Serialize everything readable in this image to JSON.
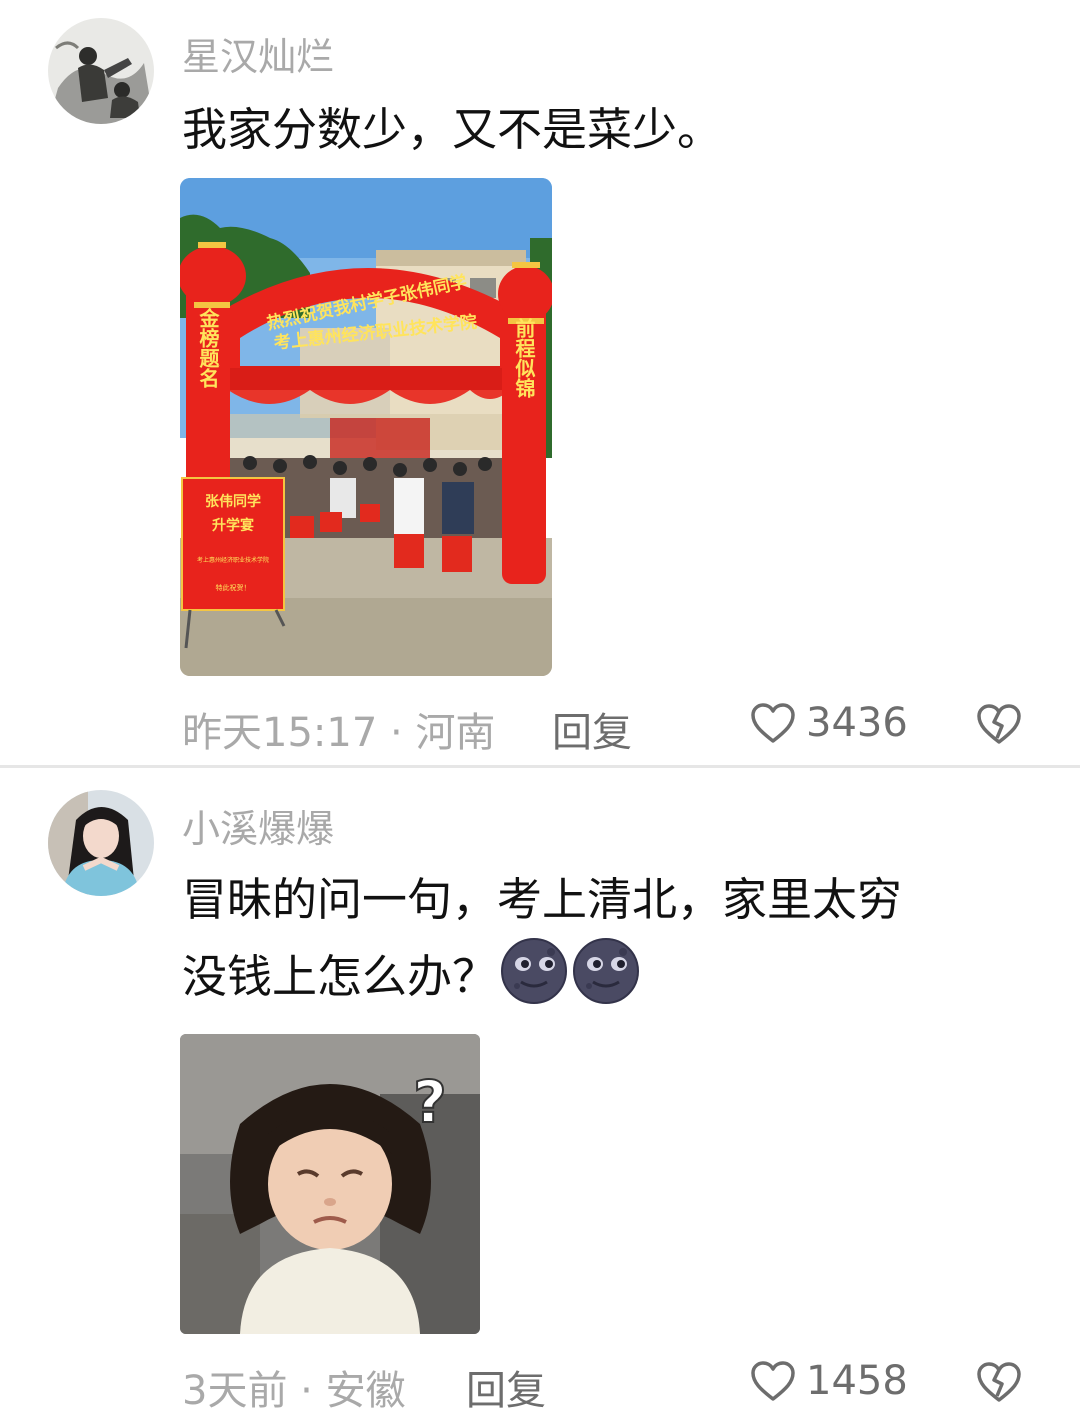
{
  "comments": [
    {
      "username": "星汉灿烂",
      "text": "我家分数少，又不是菜少。",
      "image": {
        "arch_banner_line1": "热烈祝贺我村学子张伟同学",
        "arch_banner_line2": "考上惠州经济职业技术学院",
        "left_pillar": "金榜题名",
        "right_pillar": "前程似锦",
        "sign_title_line1": "张伟同学",
        "sign_title_line2": "升学宴",
        "sign_body": "考上惠州经济职业技术学院",
        "sign_footer": "特此祝贺！"
      },
      "time": "昨天15:17",
      "location": "河南",
      "meta_separator": "·",
      "reply_label": "回复",
      "like_icon": "heart-outline-icon",
      "likes": "3436",
      "dislike_icon": "broken-heart-icon"
    },
    {
      "username": "小溪爆爆",
      "text_line1": "冒昧的问一句，考上清北，家里太穷",
      "text_line2": "没钱上怎么办？",
      "emoji": "new-moon-face-emoji",
      "image": {
        "question_mark": "?"
      },
      "time": "3天前",
      "location": "安徽",
      "meta_separator": "·",
      "reply_label": "回复",
      "like_icon": "heart-outline-icon",
      "likes": "1458",
      "dislike_icon": "broken-heart-icon"
    }
  ],
  "colors": {
    "username": "#a9a9a9",
    "meta": "#a9a9a9",
    "action": "#6d6d6d",
    "festive_red": "#e8231c",
    "gold": "#ffe45c"
  }
}
